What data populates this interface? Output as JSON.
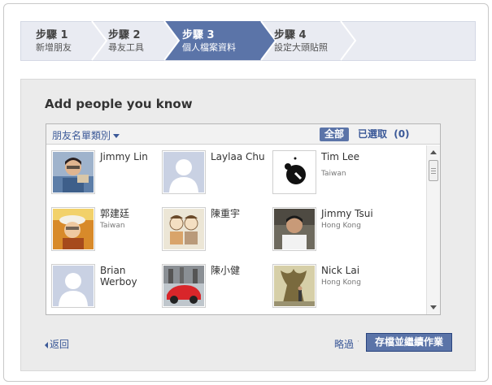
{
  "steps": [
    {
      "num": "步驟 1",
      "sub": "新增朋友"
    },
    {
      "num": "步驟 2",
      "sub": "尋友工具"
    },
    {
      "num": "步驟 3",
      "sub": "個人檔案資料"
    },
    {
      "num": "步驟 4",
      "sub": "設定大頭貼照"
    }
  ],
  "title": "Add people you know",
  "list_header": {
    "category": "朋友名單類別",
    "all": "全部",
    "selected": "已選取",
    "selected_count": "(0)"
  },
  "people": [
    {
      "name": "Jimmy Lin",
      "location": ""
    },
    {
      "name": "Laylaa Chu",
      "location": ""
    },
    {
      "name": "Tim Lee",
      "location": "Taiwan"
    },
    {
      "name": "郭建廷",
      "location": "Taiwan"
    },
    {
      "name": "陳重宇",
      "location": ""
    },
    {
      "name": "Jimmy Tsui",
      "location": "Hong Kong"
    },
    {
      "name": "Brian Werboy",
      "location": ""
    },
    {
      "name": "陳小健",
      "location": ""
    },
    {
      "name": "Nick Lai",
      "location": "Hong Kong"
    }
  ],
  "footer": {
    "back": "返回",
    "skip": "略過",
    "dot": "·",
    "save": "存檔並繼續作業"
  },
  "colors": {
    "active_step": "#5b74a8",
    "link": "#3b5998",
    "button": "#5b74a8"
  }
}
